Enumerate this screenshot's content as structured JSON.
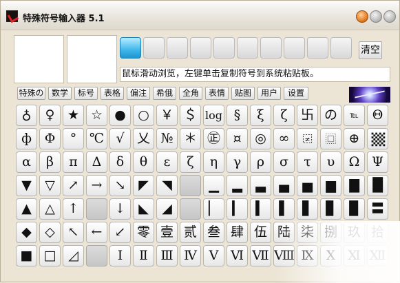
{
  "window": {
    "title": "特殊符号输入器 5.1"
  },
  "toolbar": {
    "clear_label": "清空",
    "hint": "鼠标滑动浏览，左键单击复制符号到系统粘贴板。"
  },
  "tabs": [
    "特殊の",
    "数学",
    "标号",
    "表格",
    "偏注",
    "希俄",
    "全角",
    "表情",
    "贴图",
    "用户",
    "设置"
  ],
  "symbols": [
    [
      "♁",
      "♀",
      "★",
      "☆",
      "●",
      "○",
      "￥",
      "＄",
      "log",
      "§",
      "ξ",
      "ζ",
      "卐",
      "の",
      "℡",
      "Θ"
    ],
    [
      "ф",
      "Φ",
      "°",
      "℃",
      "√",
      "乂",
      "№",
      "＊",
      "㊣",
      "¤",
      "◎",
      "∞",
      "[box-dash]",
      "[box-dots]",
      "⊕",
      "[checker]"
    ],
    [
      "α",
      "β",
      "π",
      "Δ",
      "δ",
      "θ",
      "ε",
      "ζ",
      "η",
      "γ",
      "ρ",
      "σ",
      "τ",
      "υ",
      "Ω",
      "Ψ"
    ],
    [
      "▼",
      "▽",
      "↗",
      "→",
      "↘",
      "◤",
      "◥",
      "",
      "▁",
      "▂",
      "▃",
      "▄",
      "▅",
      "▆",
      "▇",
      "█"
    ],
    [
      "▲",
      "△",
      "↑",
      "",
      "↓",
      "◣",
      "◢",
      "",
      "▏",
      "▎",
      "▍",
      "▌",
      "▋",
      "▊",
      "▉",
      "〓"
    ],
    [
      "◆",
      "◇",
      "↖",
      "←",
      "↙",
      "零",
      "壹",
      "贰",
      "叁",
      "肆",
      "伍",
      "陆",
      "柒",
      "捌",
      "玖",
      "拾"
    ],
    [
      "■",
      "□",
      "◿",
      "",
      "Ⅰ",
      "Ⅱ",
      "Ⅲ",
      "Ⅳ",
      "Ⅴ",
      "Ⅵ",
      "Ⅶ",
      "Ⅷ",
      "Ⅸ",
      "Ⅹ",
      "Ⅺ",
      "Ⅻ"
    ]
  ],
  "icons": {
    "app": "app-logo-icon",
    "minimize": "minimize-icon",
    "maximize": "maximize-icon",
    "close": "close-icon"
  },
  "colors": {
    "active_slot": "#3fb7ea",
    "minimize": "#e07a20"
  }
}
